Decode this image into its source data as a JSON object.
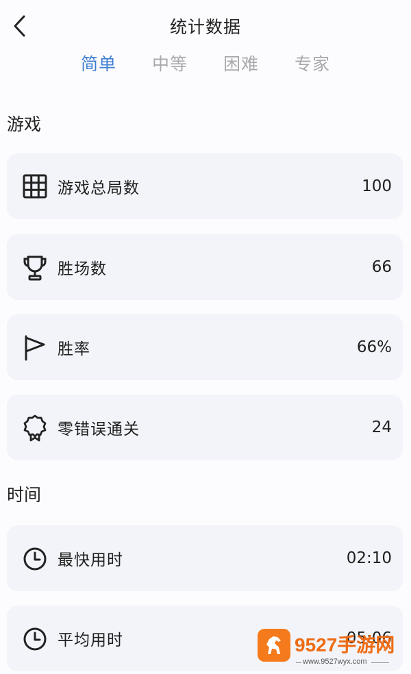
{
  "header": {
    "title": "统计数据"
  },
  "tabs": [
    {
      "label": "简单",
      "active": true
    },
    {
      "label": "中等",
      "active": false
    },
    {
      "label": "困难",
      "active": false
    },
    {
      "label": "专家",
      "active": false
    }
  ],
  "sections": {
    "game_title": "游戏",
    "time_title": "时间"
  },
  "game_stats": [
    {
      "icon": "grid-icon",
      "label": "游戏总局数",
      "value": "100"
    },
    {
      "icon": "trophy-icon",
      "label": "胜场数",
      "value": "66"
    },
    {
      "icon": "flag-icon",
      "label": "胜率",
      "value": "66%"
    },
    {
      "icon": "award-ribbon-icon",
      "label": "零错误通关",
      "value": "24"
    }
  ],
  "time_stats": [
    {
      "icon": "clock-icon",
      "label": "最快用时",
      "value": "02:10"
    },
    {
      "icon": "clock-icon",
      "label": "平均用时",
      "value": "05:06"
    }
  ],
  "watermark": {
    "brand": "9527手游网",
    "url": "www.9527wyx.com"
  },
  "colors": {
    "accent": "#3f7fd0",
    "card_bg": "#f2f4f9",
    "watermark": "#ee6b13"
  }
}
